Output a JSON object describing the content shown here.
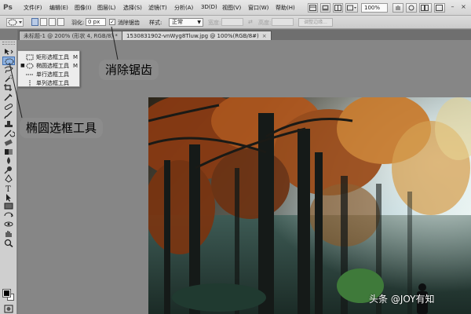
{
  "app": {
    "logo": "Ps"
  },
  "menu": [
    "文件(F)",
    "编辑(E)",
    "图像(I)",
    "图层(L)",
    "选择(S)",
    "滤镜(T)",
    "分析(A)",
    "3D(D)",
    "视图(V)",
    "窗口(W)",
    "帮助(H)"
  ],
  "menubar_right": {
    "zoom": "100%"
  },
  "options": {
    "feather_label": "羽化:",
    "feather_value": "0 px",
    "antialias_label": "消除锯齿",
    "antialias_checked": "✓",
    "style_label": "样式:",
    "style_value": "正常",
    "width_label": "宽度:",
    "height_label": "高度:",
    "refine_label": "调整边缘..."
  },
  "tabs": [
    {
      "label": "未标题-1 @ 200% (形状 4, RGB/8) *",
      "close": "×"
    },
    {
      "label": "1530831902-vnWyg8Tluw.jpg @ 100%(RGB/8#)",
      "close": "×"
    }
  ],
  "flyout": {
    "items": [
      {
        "mark": "",
        "icon": "rectangular-marquee-icon",
        "label": "矩形选框工具",
        "key": "M"
      },
      {
        "mark": "■",
        "icon": "elliptical-marquee-icon",
        "label": "椭圆选框工具",
        "key": "M"
      },
      {
        "mark": "",
        "icon": "single-row-marquee-icon",
        "label": "单行选框工具",
        "key": ""
      },
      {
        "mark": "",
        "icon": "single-column-marquee-icon",
        "label": "单列选框工具",
        "key": ""
      }
    ]
  },
  "tools": [
    "move-tool-icon",
    "elliptical-marquee-tool-icon",
    "lasso-tool-icon",
    "quick-selection-tool-icon",
    "crop-tool-icon",
    "eyedropper-tool-icon",
    "spot-healing-tool-icon",
    "brush-tool-icon",
    "clone-stamp-tool-icon",
    "history-brush-tool-icon",
    "eraser-tool-icon",
    "gradient-tool-icon",
    "blur-tool-icon",
    "dodge-tool-icon",
    "pen-tool-icon",
    "type-tool-icon",
    "path-selection-tool-icon",
    "rectangle-tool-icon",
    "3d-rotate-tool-icon",
    "3d-orbit-tool-icon",
    "hand-tool-icon",
    "zoom-tool-icon"
  ],
  "callouts": {
    "antialias": "消除锯齿",
    "elliptical": "椭圆选框工具"
  },
  "watermark": "头条 @JOY有知",
  "colors": {
    "active_tool": "#8fb3e1",
    "callout_bg": "#8c8c8c",
    "canvas_bg": "#868686"
  }
}
